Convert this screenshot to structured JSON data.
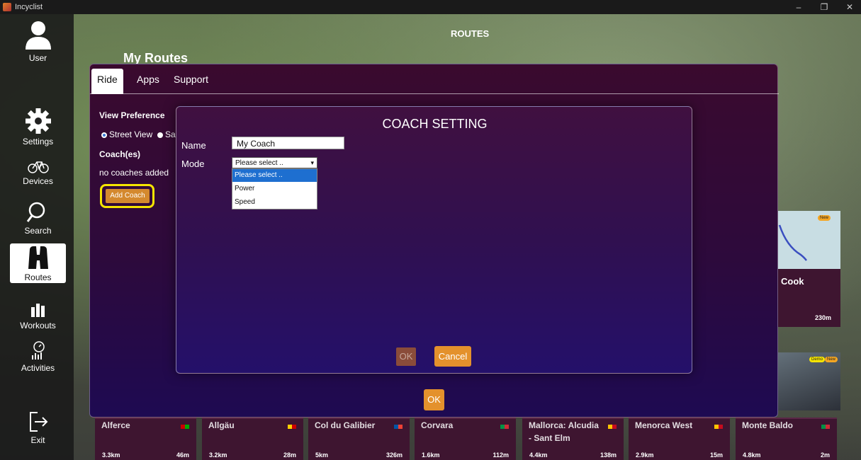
{
  "window": {
    "app_name": "Incyclist",
    "minimize_glyph": "–",
    "restore_glyph": "❐",
    "close_glyph": "✕"
  },
  "sidebar": {
    "items": [
      {
        "label": "User",
        "icon": "user-icon"
      },
      {
        "label": "Settings",
        "icon": "gear-icon"
      },
      {
        "label": "Devices",
        "icon": "bicycle-icon"
      },
      {
        "label": "Search",
        "icon": "search-icon"
      },
      {
        "label": "Routes",
        "icon": "binoculars-icon"
      },
      {
        "label": "Workouts",
        "icon": "bar-chart-icon"
      },
      {
        "label": "Activities",
        "icon": "activities-icon"
      },
      {
        "label": "Exit",
        "icon": "exit-icon"
      }
    ]
  },
  "header": {
    "title": "ROUTES",
    "section": "My Routes"
  },
  "settings_dialog": {
    "tabs": [
      "Ride",
      "Apps",
      "Support"
    ],
    "view_preference_label": "View Preference",
    "radio_street": "Street View",
    "radio_sat_partial": "Sa",
    "coaches_label": "Coach(es)",
    "no_coaches": "no coaches added",
    "add_coach": "Add Coach",
    "ok": "OK"
  },
  "coach_modal": {
    "title": "COACH SETTING",
    "name_label": "Name",
    "name_value": "My Coach",
    "mode_label": "Mode",
    "mode_selected": "Please select ..",
    "mode_options": [
      "Please select ..",
      "Power",
      "Speed"
    ],
    "ok": "OK",
    "cancel": "Cancel"
  },
  "route_cards": [
    {
      "name": "Alferce",
      "distance": "3.3km",
      "elevation": "46m"
    },
    {
      "name": "Allgäu",
      "distance": "3.2km",
      "elevation": "28m"
    },
    {
      "name": "Col du Galibier",
      "distance": "5km",
      "elevation": "326m"
    },
    {
      "name": "Corvara",
      "distance": "1.6km",
      "elevation": "112m"
    },
    {
      "name": "Mallorca: Alcudia",
      "name2": "- Sant Elm",
      "distance": "4.4km",
      "elevation": "138m"
    },
    {
      "name": "Menorca West",
      "distance": "2.9km",
      "elevation": "15m"
    },
    {
      "name": "Monte Baldo",
      "distance": "4.8km",
      "elevation": "2m"
    }
  ],
  "right_cards": {
    "card1_name": "Cook",
    "card1_elev": "230m",
    "badge_new": "New",
    "badge_demo": "Demo"
  },
  "colors": {
    "accent_orange": "#e4912c",
    "highlight_yellow": "#f5e400",
    "dialog_top": "#3a0a2e",
    "dialog_bottom": "#1e0a52"
  }
}
